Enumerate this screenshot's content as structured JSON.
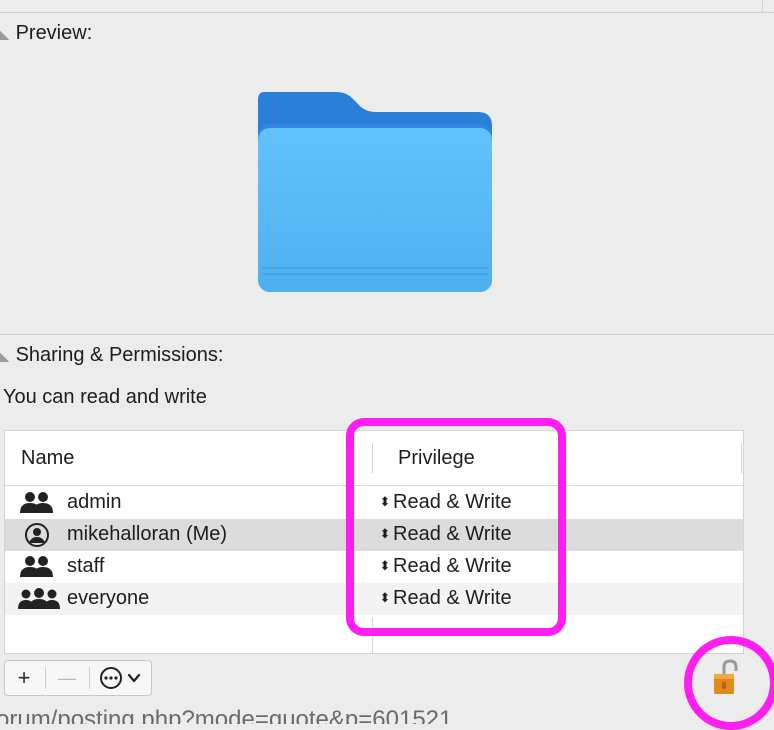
{
  "preview": {
    "heading": "Preview:"
  },
  "sharing": {
    "heading": "Sharing & Permissions:",
    "subtext": "You can read and write",
    "columns": {
      "name": "Name",
      "privilege": "Privilege"
    },
    "rows": [
      {
        "name": "admin",
        "privilege": "Read & Write",
        "icon": "group-icon"
      },
      {
        "name": "mikehalloran (Me)",
        "privilege": "Read & Write",
        "icon": "user-circle-icon"
      },
      {
        "name": "staff",
        "privilege": "Read & Write",
        "icon": "group-icon"
      },
      {
        "name": "everyone",
        "privilege": "Read & Write",
        "icon": "group-large-icon"
      }
    ]
  },
  "toolbar": {
    "add": "+",
    "remove": "—",
    "actions_icon": "ellipsis-circle-icon",
    "chevron": "chevron-down-icon"
  },
  "lock": {
    "state": "unlocked",
    "icon": "lock-open-icon"
  },
  "colors": {
    "highlight": "#ff1df0",
    "folder": "#5ab8f5",
    "selected_row": "#dcdcdc"
  },
  "background_text": "orum/posting.php?mode=quote&p=601521"
}
